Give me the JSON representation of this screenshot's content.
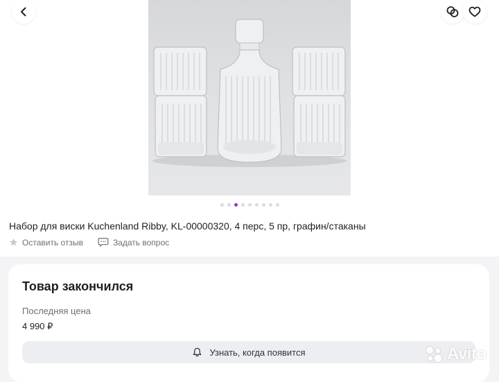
{
  "product": {
    "title": "Набор для виски Kuchenland Ribby, KL-00000320, 4 перс, 5 пр, графин/стаканы",
    "review_label": "Оставить отзыв",
    "question_label": "Задать вопрос"
  },
  "gallery": {
    "image_count": 9,
    "active_index": 2,
    "colors": {
      "active_dot": "#8b3ac9",
      "inactive_dot": "#dcdcdf"
    }
  },
  "icons": {
    "back": "chevron-left-icon",
    "compare": "compare-icon",
    "favorite": "heart-icon",
    "review": "star-icon",
    "question": "chat-bubble-icon",
    "notify": "bell-icon"
  },
  "stock": {
    "status_title": "Товар закончился",
    "last_price_label": "Последняя цена",
    "last_price": "4 990 ₽",
    "notify_label": "Узнать, когда появится"
  },
  "watermark": {
    "text": "Avito"
  }
}
